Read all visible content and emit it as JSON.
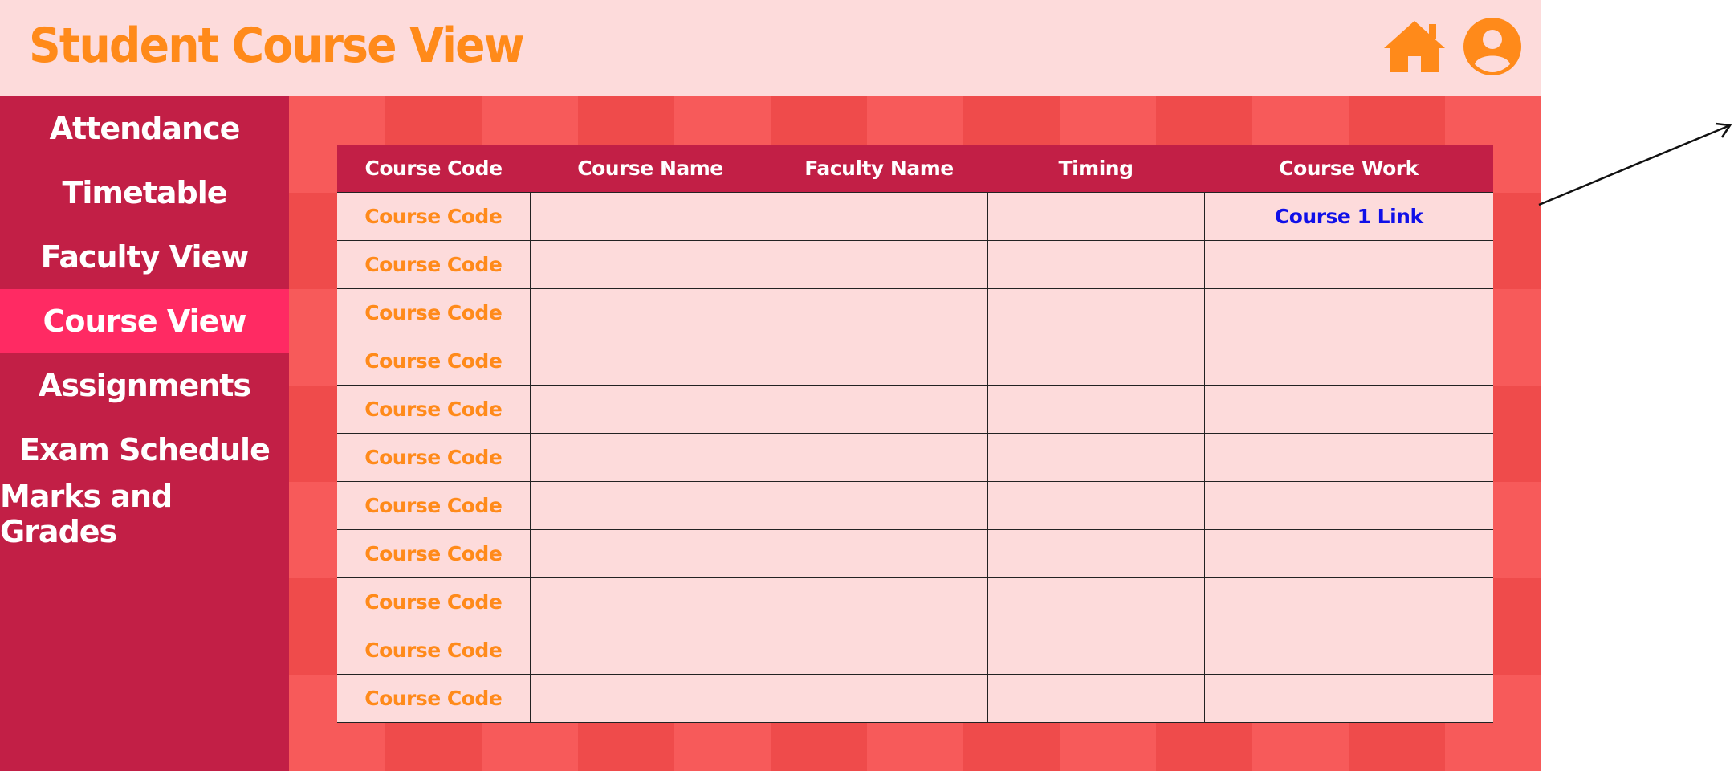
{
  "header": {
    "title": "Student Course View",
    "icons": [
      "home-icon",
      "user-profile-icon"
    ],
    "icon_color": "#ff8a1a"
  },
  "sidebar": {
    "active_index": 3,
    "items": [
      {
        "label": "Attendance"
      },
      {
        "label": "Timetable"
      },
      {
        "label": "Faculty View"
      },
      {
        "label": "Course View"
      },
      {
        "label": "Assignments"
      },
      {
        "label": "Exam Schedule"
      },
      {
        "label": "Marks and Grades"
      }
    ]
  },
  "table": {
    "columns": [
      "Course Code",
      "Course Name",
      "Faculty Name",
      "Timing",
      "Course Work"
    ],
    "rows": [
      {
        "code": "Course Code",
        "name": "",
        "faculty": "",
        "timing": "",
        "work": "Course 1 Link"
      },
      {
        "code": "Course Code",
        "name": "",
        "faculty": "",
        "timing": "",
        "work": ""
      },
      {
        "code": "Course Code",
        "name": "",
        "faculty": "",
        "timing": "",
        "work": ""
      },
      {
        "code": "Course Code",
        "name": "",
        "faculty": "",
        "timing": "",
        "work": ""
      },
      {
        "code": "Course Code",
        "name": "",
        "faculty": "",
        "timing": "",
        "work": ""
      },
      {
        "code": "Course Code",
        "name": "",
        "faculty": "",
        "timing": "",
        "work": ""
      },
      {
        "code": "Course Code",
        "name": "",
        "faculty": "",
        "timing": "",
        "work": ""
      },
      {
        "code": "Course Code",
        "name": "",
        "faculty": "",
        "timing": "",
        "work": ""
      },
      {
        "code": "Course Code",
        "name": "",
        "faculty": "",
        "timing": "",
        "work": ""
      },
      {
        "code": "Course Code",
        "name": "",
        "faculty": "",
        "timing": "",
        "work": ""
      },
      {
        "code": "Course Code",
        "name": "",
        "faculty": "",
        "timing": "",
        "work": ""
      }
    ]
  },
  "colors": {
    "header_bg": "#fddbdb",
    "sidebar_bg": "#c21f46",
    "sidebar_active": "#ff2a63",
    "main_bg_light": "#f75a5a",
    "main_bg_dark": "#ef4b4b",
    "accent_orange": "#ff8a1a",
    "link_blue": "#1010e8"
  }
}
